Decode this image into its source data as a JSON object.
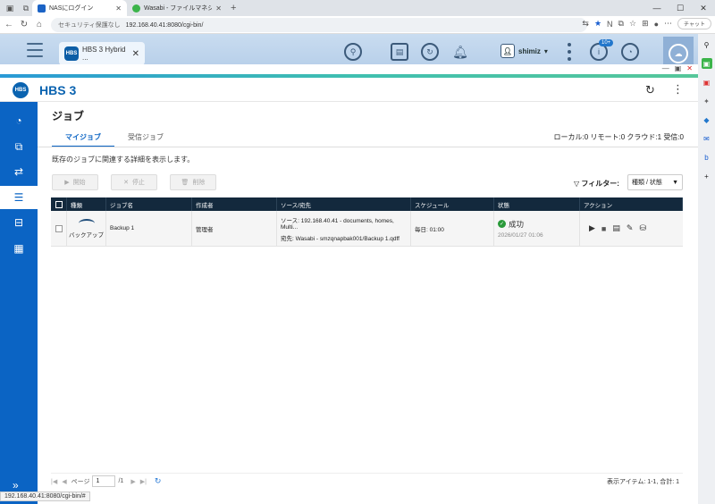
{
  "browser": {
    "tabs": [
      {
        "title": "NASにログイン",
        "active": true
      },
      {
        "title": "Wasabi - ファイルマネジャー - sesszy",
        "active": false
      }
    ],
    "security_label": "セキュリティ保護なし",
    "url": "192.168.40.41:8080/cgi-bin/",
    "chat_label": "チャット",
    "status_url": "192.168.40.41:8080/cgi-bin/#"
  },
  "qts": {
    "app_tab_title": "HBS 3 Hybrid ...",
    "app_icon_text": "HBS",
    "username": "shimiz",
    "notification_badge": "10+"
  },
  "app": {
    "name": "HBS 3",
    "logo_text": "HBS"
  },
  "page": {
    "title": "ジョブ",
    "tabs": [
      "マイジョブ",
      "受信ジョブ"
    ],
    "counts": {
      "local_label": "ローカル:",
      "local": "0",
      "remote_label": "リモート:",
      "remote": "0",
      "cloud_label": "クラウド:",
      "cloud": "1",
      "inbound_label": "受信:",
      "inbound": "0"
    },
    "description": "既存のジョブに関連する詳細を表示します。",
    "buttons": {
      "start": "開始",
      "stop": "停止",
      "delete": "削除"
    },
    "filter_label": "フィルター:",
    "filter_value": "種類 / 状態"
  },
  "table": {
    "headers": [
      "種類",
      "ジョブ名",
      "作成者",
      "ソース/宛先",
      "スケジュール",
      "状態",
      "アクション"
    ],
    "rows": [
      {
        "type": "バックアップ",
        "name": "Backup 1",
        "creator": "管理者",
        "source": "ソース: 192.168.40.41 - documents, homes, Multi...",
        "dest": "宛先: Wasabi - smzqnapbak001/Backup 1.qdff",
        "schedule": "毎日: 01:00",
        "status": "成功",
        "status_time": "2026/01/27 01:06"
      }
    ]
  },
  "pager": {
    "page_label": "ページ",
    "page_value": "1",
    "page_total": "/1",
    "items_text": "表示アイテム: 1-1, 合計: 1"
  }
}
